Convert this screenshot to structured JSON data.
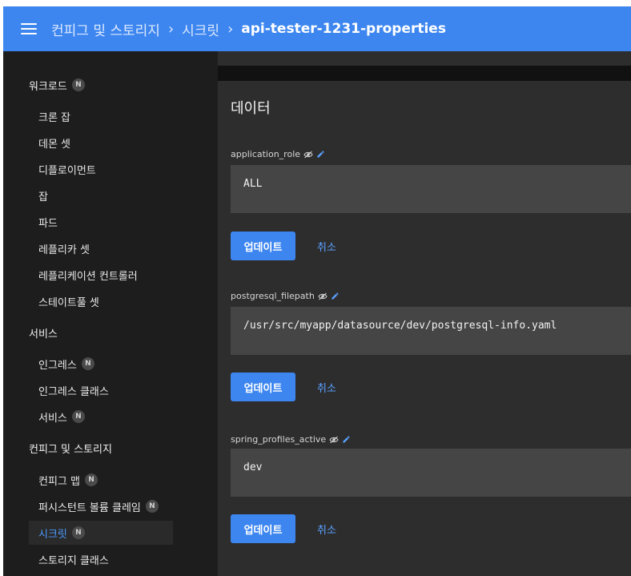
{
  "header": {
    "breadcrumbs": [
      "컨피그 및 스토리지",
      "시크릿"
    ],
    "separator": "›",
    "current": "api-tester-1231-properties"
  },
  "sidebar": {
    "workloads": {
      "label": "워크로드",
      "badge": "N",
      "items": [
        "크론 잡",
        "데몬 셋",
        "디플로이먼트",
        "잡",
        "파드",
        "레플리카 셋",
        "레플리케이션 컨트롤러",
        "스테이트풀 셋"
      ]
    },
    "services": {
      "label": "서비스",
      "items": [
        {
          "label": "인그레스",
          "badge": "N"
        },
        {
          "label": "인그레스 클래스"
        },
        {
          "label": "서비스",
          "badge": "N"
        }
      ]
    },
    "config": {
      "label": "컨피그 및 스토리지",
      "items": [
        {
          "label": "컨피그 맵",
          "badge": "N"
        },
        {
          "label": "퍼시스턴트 볼륨 클레임",
          "badge": "N"
        },
        {
          "label": "시크릿",
          "badge": "N"
        },
        {
          "label": "스토리지 클래스"
        }
      ]
    }
  },
  "main": {
    "title": "데이터",
    "fields": [
      {
        "key": "application_role",
        "value": "ALL",
        "update_label": "업데이트",
        "cancel_label": "취소"
      },
      {
        "key": "postgresql_filepath",
        "value": "/usr/src/myapp/datasource/dev/postgresql-info.yaml",
        "update_label": "업데이트",
        "cancel_label": "취소"
      },
      {
        "key": "spring_profiles_active",
        "value": "dev",
        "update_label": "업데이트",
        "cancel_label": "취소"
      }
    ]
  },
  "colors": {
    "accent": "#3d86f0",
    "link": "#5aa0ff",
    "sidebar_bg": "#1d1d1d",
    "card_bg": "#2d2d2d",
    "field_bg": "#454545"
  }
}
